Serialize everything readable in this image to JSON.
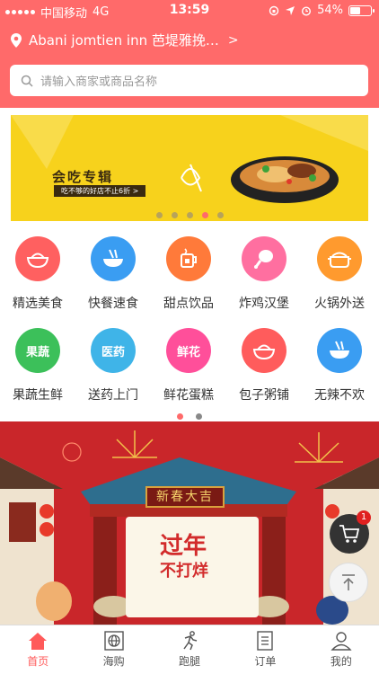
{
  "status_bar": {
    "carrier": "中国移动",
    "network": "4G",
    "time": "13:59",
    "battery_percent_label": "54%",
    "battery_level": 0.54
  },
  "header": {
    "location": "Abani jomtien inn 芭堤雅挽…",
    "search_placeholder": "请输入商家或商品名称"
  },
  "banner": {
    "title": "会吃专辑",
    "subtitle": "吃不够的好店不止6折 >",
    "dot_count": 5,
    "active_dot": 3
  },
  "categories": [
    {
      "label": "精选美食",
      "icon": "rice-bowl-icon",
      "color": "#ff6060",
      "glyph": ""
    },
    {
      "label": "快餐速食",
      "icon": "noodle-bowl-icon",
      "color": "#3a9df2",
      "glyph": ""
    },
    {
      "label": "甜点饮品",
      "icon": "drink-cup-icon",
      "color": "#ff7a3a",
      "glyph": ""
    },
    {
      "label": "炸鸡汉堡",
      "icon": "chicken-leg-icon",
      "color": "#ff6fa0",
      "glyph": ""
    },
    {
      "label": "火锅外送",
      "icon": "hotpot-icon",
      "color": "#ff9a2e",
      "glyph": ""
    },
    {
      "label": "果蔬生鲜",
      "icon": "fruit-icon",
      "color": "#3cc05a",
      "glyph": "果蔬"
    },
    {
      "label": "送药上门",
      "icon": "medicine-icon",
      "color": "#3fb4e8",
      "glyph": "医药"
    },
    {
      "label": "鲜花蛋糕",
      "icon": "flower-icon",
      "color": "#ff4f9a",
      "glyph": "鲜花"
    },
    {
      "label": "包子粥铺",
      "icon": "porridge-icon",
      "color": "#ff5c5c",
      "glyph": ""
    },
    {
      "label": "无辣不欢",
      "icon": "spicy-bowl-icon",
      "color": "#3a9df2",
      "glyph": ""
    }
  ],
  "grid_pager": {
    "dot_count": 2,
    "active_dot": 0
  },
  "festival": {
    "sign": "新春大吉",
    "line1": "过年",
    "line2": "不打烊"
  },
  "cart": {
    "badge": "1"
  },
  "tabs": [
    {
      "label": "首页",
      "icon": "home-icon",
      "active": true
    },
    {
      "label": "海购",
      "icon": "globe-icon",
      "active": false
    },
    {
      "label": "跑腿",
      "icon": "runner-icon",
      "active": false
    },
    {
      "label": "订单",
      "icon": "order-list-icon",
      "active": false
    },
    {
      "label": "我的",
      "icon": "user-icon",
      "active": false
    }
  ],
  "colors": {
    "brand": "#ff6a6a",
    "active_tab": "#ff5a5a"
  }
}
